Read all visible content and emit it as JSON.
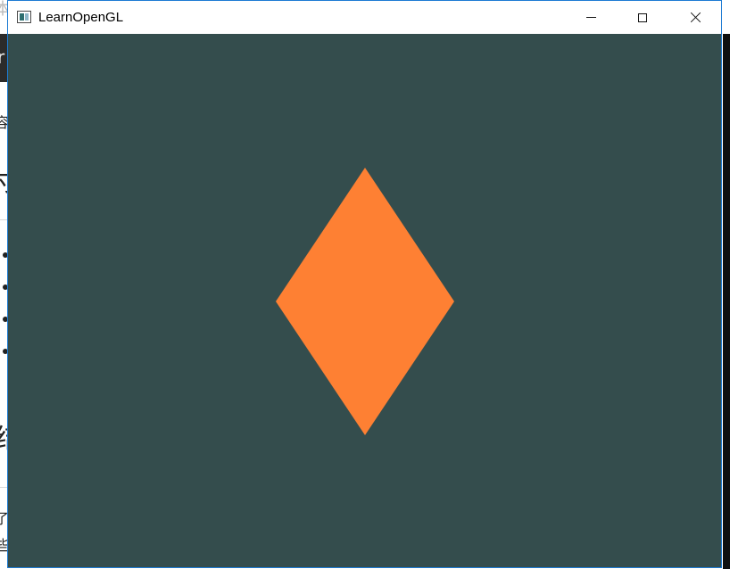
{
  "window": {
    "title": "LearnOpenGL"
  },
  "caption_buttons": {
    "minimize_icon": "minimize-icon",
    "maximize_icon": "maximize-icon",
    "close_icon": "close-icon"
  },
  "scene": {
    "clear_color": "#344d4d",
    "shape": "diamond",
    "shape_color": "#fe8033"
  },
  "background_page": {
    "glyphs": [
      "本",
      "r",
      "容",
      "寸",
      "结",
      "了",
      "些"
    ]
  }
}
